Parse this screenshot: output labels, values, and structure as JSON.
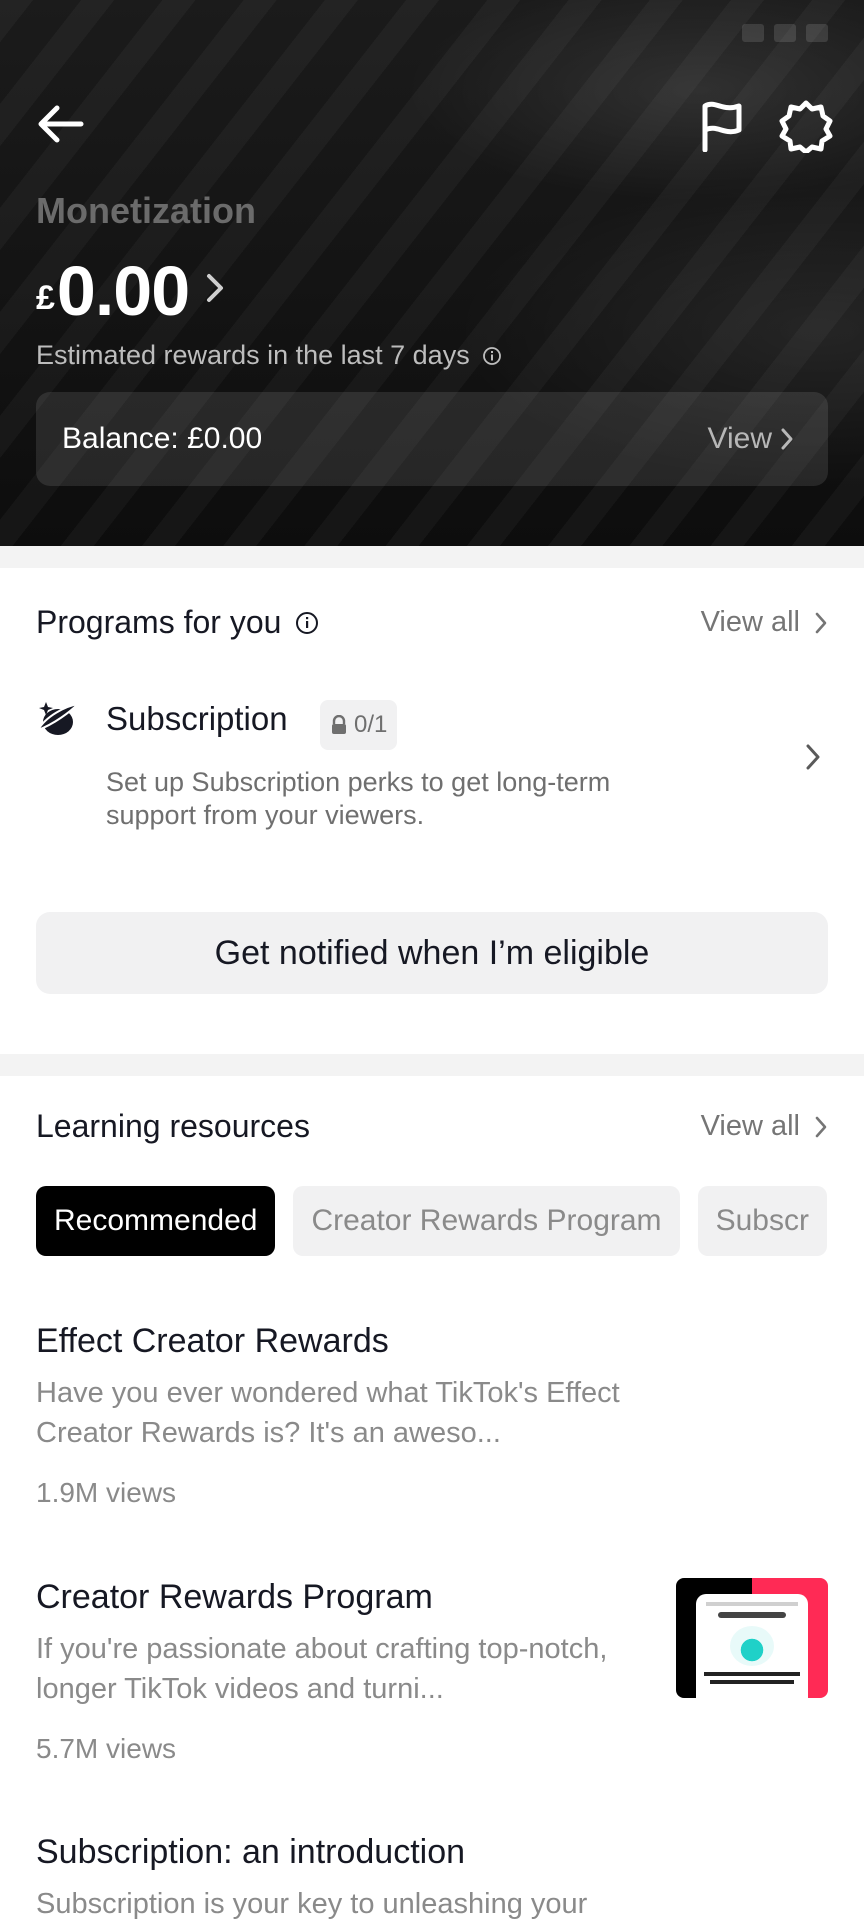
{
  "header": {
    "title": "Monetization",
    "currency": "£",
    "amount": "0.00",
    "estimated_label": "Estimated rewards in the last 7 days",
    "balance_label": "Balance: £0.00",
    "balance_view": "View",
    "icons": [
      "back-arrow-icon",
      "flag-icon",
      "settings-gear-icon"
    ]
  },
  "programs": {
    "title": "Programs for you",
    "view_all": "View all",
    "items": [
      {
        "name": "Subscription",
        "badge": "0/1",
        "description": "Set up Subscription perks to get long-term support from your viewers."
      }
    ],
    "notify_button": "Get notified when I’m eligible"
  },
  "learning": {
    "title": "Learning resources",
    "view_all": "View all",
    "chips": [
      "Recommended",
      "Creator Rewards Program",
      "Subscr"
    ],
    "articles": [
      {
        "title": "Effect Creator Rewards",
        "description": "Have you ever wondered what TikTok's Effect Creator Rewards is? It's an aweso...",
        "views": "1.9M views"
      },
      {
        "title": "Creator Rewards Program",
        "description": "If you're passionate about crafting top-notch, longer TikTok videos and turni...",
        "views": "5.7M views"
      },
      {
        "title": "Subscription: an introduction",
        "description": "Subscription is your key to unleashing your"
      }
    ]
  },
  "colors": {
    "accent": "#ff2a55",
    "chip_active_bg": "#000000",
    "muted_text": "#8a8a8a"
  }
}
